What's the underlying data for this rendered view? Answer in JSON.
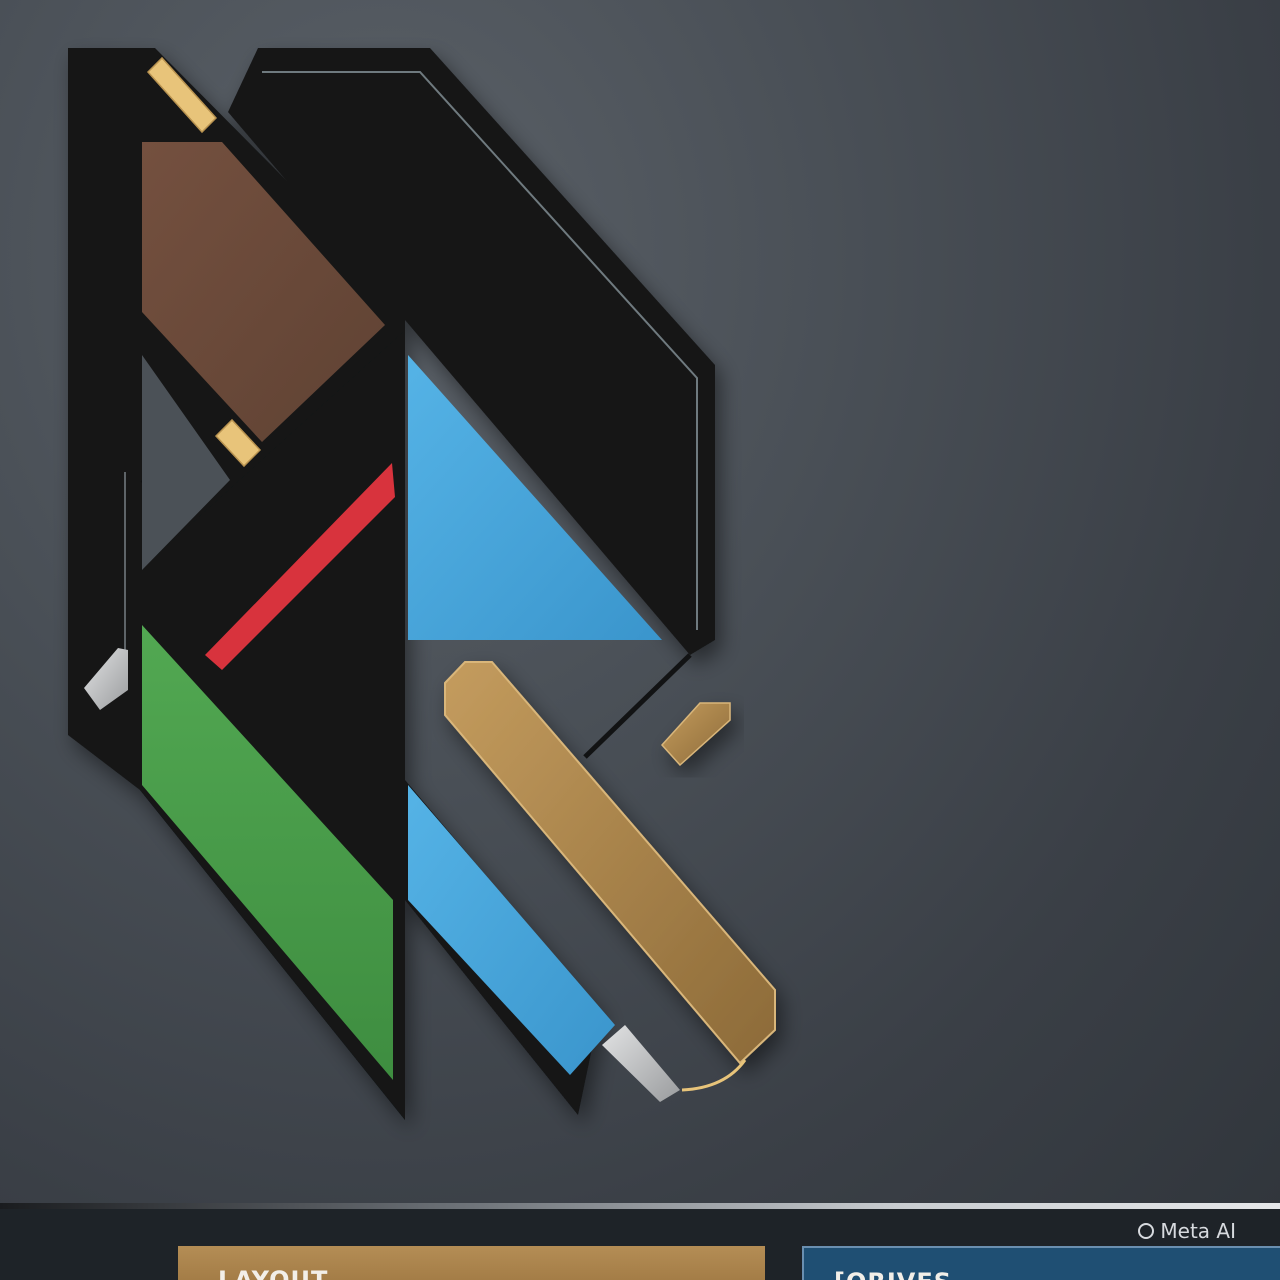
{
  "watermark": {
    "text": "Meta AI"
  },
  "footer": {
    "left_panel_label": "LAYOUT",
    "right_panel_label": "[ORIVES"
  },
  "colors": {
    "background": "#4a5057",
    "emblem_black": "#151617",
    "brown": "#6b4a3a",
    "sky_blue": "#4aa8dc",
    "red": "#d8333d",
    "green": "#4a9c4a",
    "gold": "#a88450",
    "gold_light": "#e8c47a",
    "silver": "#c9cbcd",
    "footer_dark": "#1e2328",
    "footer_blue": "#1f4f73"
  }
}
